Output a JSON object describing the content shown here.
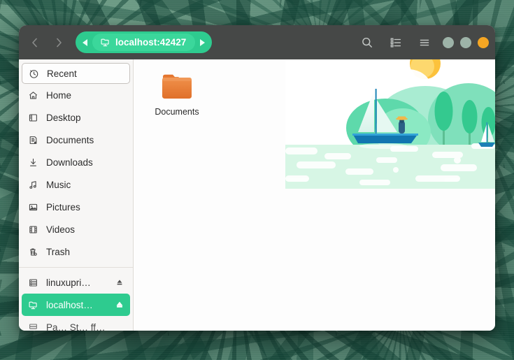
{
  "desktop": {
    "wallpaper_name": "green-botanical-wallpaper"
  },
  "window": {
    "title": "localhost:42427",
    "headerbar": {
      "back_label": "Back",
      "forward_label": "Forward",
      "pathbar": {
        "scroll_left_label": "Scroll path left",
        "scroll_right_label": "Scroll path right",
        "crumbs": [
          {
            "label": "localhost:42427",
            "icon": "remote-folder-icon",
            "active": true
          }
        ]
      },
      "search_label": "Search",
      "view_toggle_label": "List view",
      "menu_label": "Main menu",
      "window_controls": [
        {
          "name": "minimize",
          "color": "#9db3a8"
        },
        {
          "name": "maximize",
          "color": "#9db3a8"
        },
        {
          "name": "close",
          "color": "#f5a623"
        }
      ]
    },
    "sidebar": {
      "places": [
        {
          "label": "Recent",
          "icon": "clock-icon",
          "state": "focused"
        },
        {
          "label": "Home",
          "icon": "home-icon",
          "state": "normal"
        },
        {
          "label": "Desktop",
          "icon": "desktop-icon",
          "state": "normal"
        },
        {
          "label": "Documents",
          "icon": "document-icon",
          "state": "normal"
        },
        {
          "label": "Downloads",
          "icon": "download-icon",
          "state": "normal"
        },
        {
          "label": "Music",
          "icon": "music-icon",
          "state": "normal"
        },
        {
          "label": "Pictures",
          "icon": "picture-icon",
          "state": "normal"
        },
        {
          "label": "Videos",
          "icon": "video-icon",
          "state": "normal"
        },
        {
          "label": "Trash",
          "icon": "trash-icon",
          "state": "normal"
        }
      ],
      "devices": [
        {
          "label": "linuxupri…",
          "icon": "drive-icon",
          "state": "normal",
          "eject": true
        },
        {
          "label": "localhost…",
          "icon": "remote-folder-icon",
          "state": "selected",
          "eject": true
        },
        {
          "label": "Pa… St… ff…",
          "icon": "drive-icon",
          "state": "clipped",
          "eject": false
        }
      ]
    },
    "content": {
      "files": [
        {
          "label": "Documents",
          "icon": "folder-icon",
          "color": "#e8803a"
        }
      ],
      "illustration": {
        "name": "sailboat-landscape-illustration",
        "elements": [
          "sun",
          "clouds",
          "hills",
          "trees",
          "sailboat",
          "sailor-with-straw-hat",
          "small-sailboat",
          "water"
        ]
      }
    }
  },
  "colors": {
    "accent_green": "#2ecb8f",
    "pathbar_crumb": "#3bd79b",
    "headerbar": "#464847",
    "sidebar_bg": "#f7f6f5",
    "content_bg": "#fdfdfd",
    "folder_orange": "#e8803a",
    "close_amber": "#f5a623"
  }
}
